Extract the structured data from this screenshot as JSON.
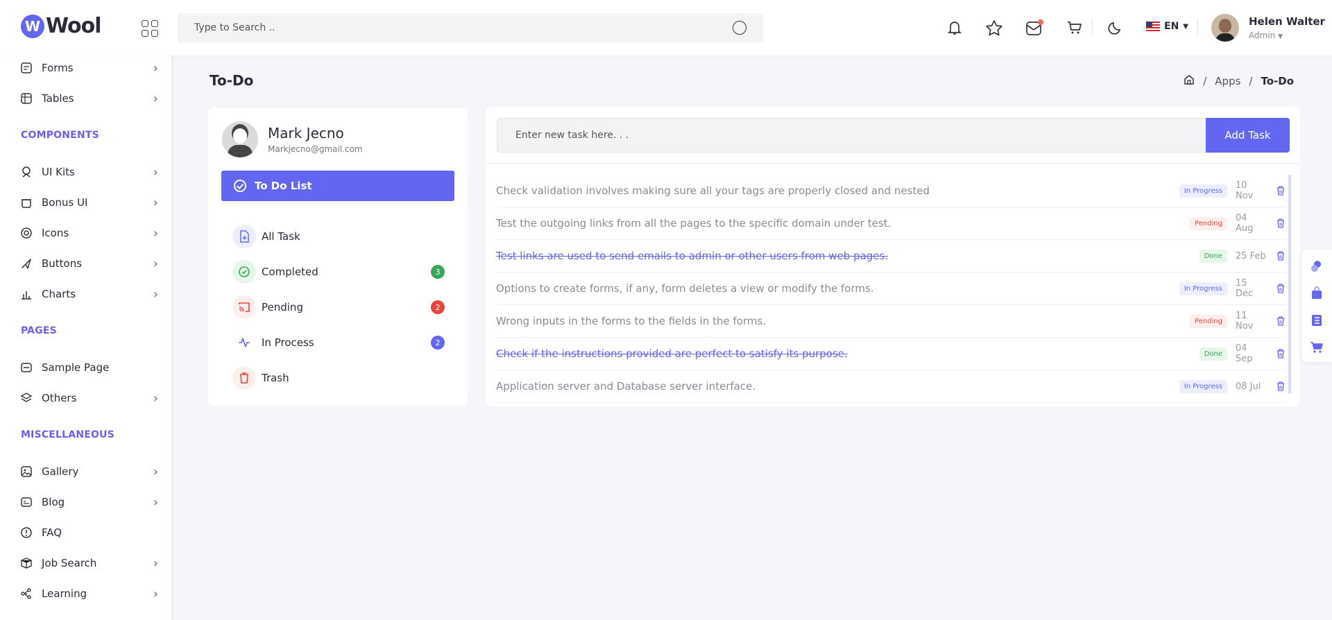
{
  "brand": {
    "logo_letter": "W",
    "name": "Wool"
  },
  "search": {
    "placeholder": "Type to Search .."
  },
  "header": {
    "language": "EN",
    "user_name": "Helen Walter",
    "user_role": "Admin"
  },
  "sidebar": {
    "items_top": [
      {
        "label": "Forms",
        "icon": "forms-icon",
        "chevron": true
      },
      {
        "label": "Tables",
        "icon": "tables-icon",
        "chevron": true
      }
    ],
    "section_components": "COMPONENTS",
    "components": [
      {
        "label": "UI Kits",
        "icon": "ui-kits-icon",
        "chevron": true
      },
      {
        "label": "Bonus UI",
        "icon": "bonus-ui-icon",
        "chevron": true
      },
      {
        "label": "Icons",
        "icon": "icons-icon",
        "chevron": true
      },
      {
        "label": "Buttons",
        "icon": "buttons-icon",
        "chevron": true
      },
      {
        "label": "Charts",
        "icon": "charts-icon",
        "chevron": true
      }
    ],
    "section_pages": "PAGES",
    "pages": [
      {
        "label": "Sample Page",
        "icon": "sample-page-icon",
        "chevron": false
      },
      {
        "label": "Others",
        "icon": "others-icon",
        "chevron": true
      }
    ],
    "section_misc": "MISCELLANEOUS",
    "misc": [
      {
        "label": "Gallery",
        "icon": "gallery-icon",
        "chevron": true
      },
      {
        "label": "Blog",
        "icon": "blog-icon",
        "chevron": true
      },
      {
        "label": "FAQ",
        "icon": "faq-icon",
        "chevron": false
      },
      {
        "label": "Job Search",
        "icon": "job-search-icon",
        "chevron": true
      },
      {
        "label": "Learning",
        "icon": "learning-icon",
        "chevron": true
      }
    ]
  },
  "page": {
    "title": "To-Do",
    "breadcrumb": [
      "Apps",
      "To-Do"
    ]
  },
  "profile": {
    "name": "Mark Jecno",
    "email": "Markjecno@gmail.com"
  },
  "todo_list_label": "To Do List",
  "filters": [
    {
      "label": "All Task",
      "icon": "file-plus-icon",
      "count": "",
      "color": "#6366f1"
    },
    {
      "label": "Completed",
      "icon": "check-circle-icon",
      "count": "3",
      "color": "#3aa55a"
    },
    {
      "label": "Pending",
      "icon": "cast-icon",
      "count": "2",
      "color": "#e8453c"
    },
    {
      "label": "In Process",
      "icon": "activity-icon",
      "count": "2",
      "color": "#6366f1"
    },
    {
      "label": "Trash",
      "icon": "trash-icon",
      "count": "",
      "color": "#e8453c"
    }
  ],
  "new_task": {
    "placeholder": "Enter new task here. . .",
    "button": "Add Task"
  },
  "tasks": [
    {
      "text": "Check validation involves making sure all your tags are properly closed and nested",
      "status": "In Progress",
      "date": "10 Nov",
      "done": false
    },
    {
      "text": "Test the outgoing links from all the pages to the specific domain under test.",
      "status": "Pending",
      "date": "04 Aug",
      "done": false
    },
    {
      "text": "Test links are used to send emails to admin or other users from web pages.",
      "status": "Done",
      "date": "25 Feb",
      "done": true
    },
    {
      "text": "Options to create forms, if any, form deletes a view or modify the forms.",
      "status": "In Progress",
      "date": "15 Dec",
      "done": false
    },
    {
      "text": "Wrong inputs in the forms to the fields in the forms.",
      "status": "Pending",
      "date": "11 Nov",
      "done": false
    },
    {
      "text": "Check if the instructions provided are perfect to satisfy its purpose.",
      "status": "Done",
      "date": "04 Sep",
      "done": true
    },
    {
      "text": "Application server and Database server interface.",
      "status": "In Progress",
      "date": "08 Jul",
      "done": false
    }
  ],
  "colors": {
    "accent": "#6366f1",
    "danger": "#e8453c",
    "success": "#3aa55a"
  }
}
